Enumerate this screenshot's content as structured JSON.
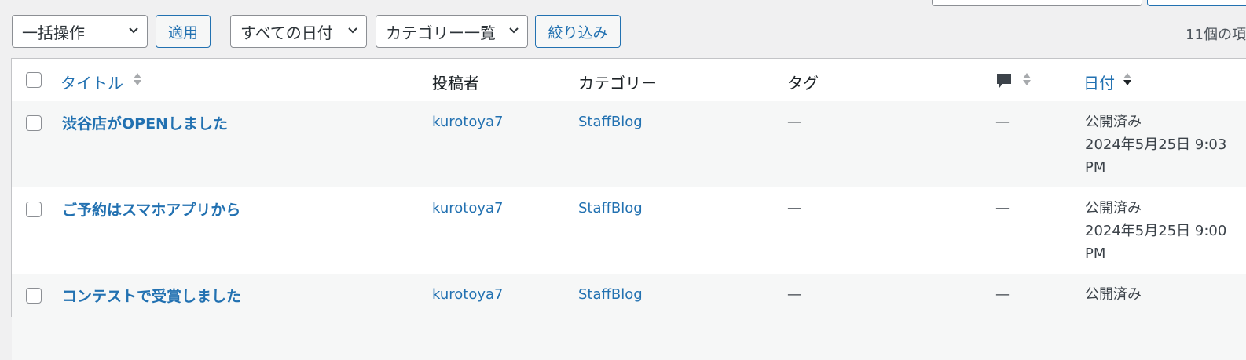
{
  "bulk_action": {
    "selected": "一括操作",
    "apply_label": "適用"
  },
  "date_filter": {
    "selected": "すべての日付"
  },
  "category_filter": {
    "selected": "カテゴリー一覧"
  },
  "filter_button": "絞り込み",
  "item_count": "11個の項",
  "columns": {
    "title": "タイトル",
    "author": "投稿者",
    "categories": "カテゴリー",
    "tags": "タグ",
    "comments_icon": "comment-bubble-icon",
    "date": "日付"
  },
  "rows": [
    {
      "title": "渋谷店がOPENしました",
      "author": "kurotoya7",
      "category": "StaffBlog",
      "tags": "—",
      "comments": "—",
      "status": "公開済み",
      "date": "2024年5月25日 9:03",
      "time_suffix": "PM"
    },
    {
      "title": "ご予約はスマホアプリから",
      "author": "kurotoya7",
      "category": "StaffBlog",
      "tags": "—",
      "comments": "—",
      "status": "公開済み",
      "date": "2024年5月25日 9:00",
      "time_suffix": "PM"
    },
    {
      "title": "コンテストで受賞しました",
      "author": "kurotoya7",
      "category": "StaffBlog",
      "tags": "—",
      "comments": "—",
      "status": "公開済み",
      "date": "",
      "time_suffix": ""
    }
  ],
  "colors": {
    "link": "#2271b1",
    "border": "#c3c4c7",
    "alt_row": "#f6f7f7",
    "bg": "#f0f0f1"
  }
}
